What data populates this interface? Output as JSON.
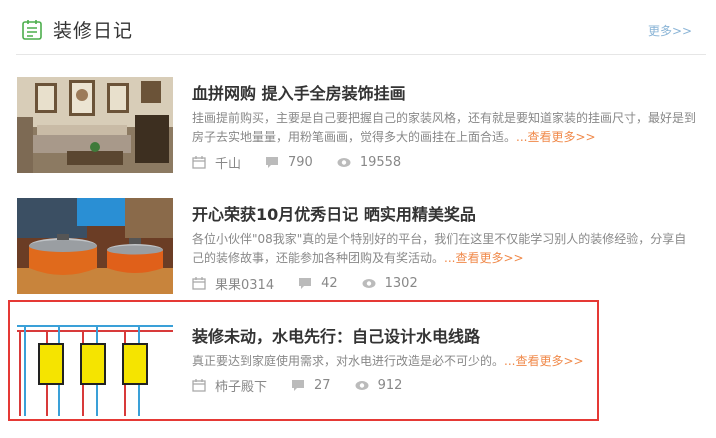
{
  "header": {
    "title": "装修日记",
    "more": "更多>>"
  },
  "articles": [
    {
      "title": "血拼网购 提入手全房装饰挂画",
      "desc": "挂画提前购买，主要是自己要把握自己的家装风格，还有就是要知道家装的挂画尺寸，最好是到房子去实地量量，用粉笔画画，觉得多大的画挂在上面合适。",
      "more": "...查看更多>>",
      "author": "千山",
      "comments": "790",
      "views": "19558",
      "image": "living-room-wall-paintings"
    },
    {
      "title": "开心荣获10月优秀日记 晒实用精美奖品",
      "desc": "各位小伙伴\"08我家\"真的是个特别好的平台，我们在这里不仅能学习别人的装修经验，分享自己的装修故事，还能参加各种团购及有奖活动。",
      "more": "...查看更多>>",
      "author": "果果0314",
      "comments": "42",
      "views": "1302",
      "image": "orange-cooking-pots"
    },
    {
      "title": "装修未动，水电先行：自己设计水电线路",
      "desc": "真正要达到家庭使用需求，对水电进行改造是必不可少的。",
      "more": "...查看更多>>",
      "author": "柿子殿下",
      "comments": "27",
      "views": "912",
      "image": "wiring-diagram"
    }
  ],
  "colors": {
    "accent_more": "#f08a4b",
    "highlight_border": "#e53935",
    "header_more": "#8ab4d6"
  }
}
